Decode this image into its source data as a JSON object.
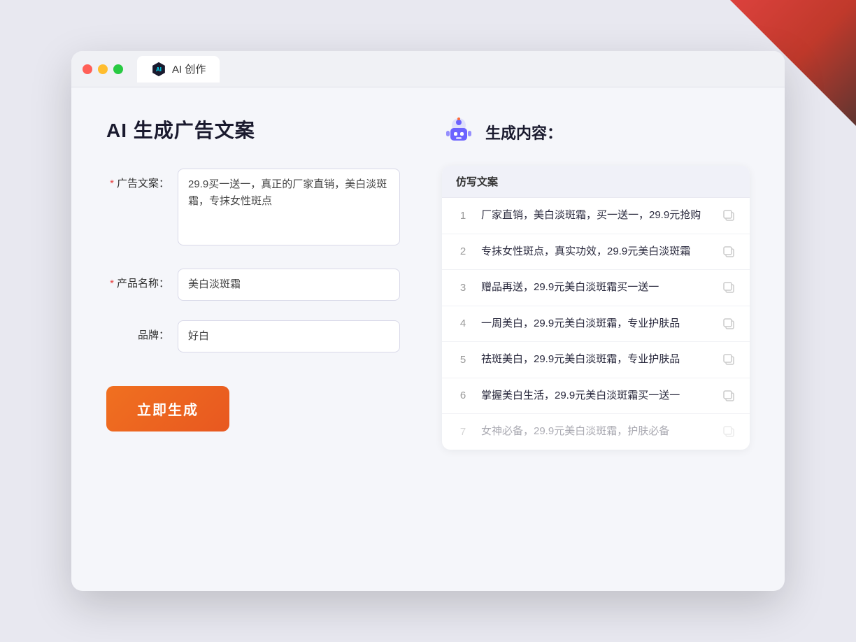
{
  "window": {
    "tab_label": "AI 创作"
  },
  "left_panel": {
    "title": "AI 生成广告文案",
    "fields": [
      {
        "id": "ad_copy",
        "label": "广告文案：",
        "required": true,
        "type": "textarea",
        "value": "29.9买一送一，真正的厂家直销，美白淡斑霜，专抹女性斑点"
      },
      {
        "id": "product_name",
        "label": "产品名称：",
        "required": true,
        "type": "input",
        "value": "美白淡斑霜"
      },
      {
        "id": "brand",
        "label": "品牌：",
        "required": false,
        "type": "input",
        "value": "好白"
      }
    ],
    "generate_button": "立即生成"
  },
  "right_panel": {
    "title": "生成内容：",
    "table_header": "仿写文案",
    "results": [
      {
        "num": "1",
        "text": "厂家直销，美白淡斑霜，买一送一，29.9元抢购",
        "faded": false
      },
      {
        "num": "2",
        "text": "专抹女性斑点，真实功效，29.9元美白淡斑霜",
        "faded": false
      },
      {
        "num": "3",
        "text": "赠品再送，29.9元美白淡斑霜买一送一",
        "faded": false
      },
      {
        "num": "4",
        "text": "一周美白，29.9元美白淡斑霜，专业护肤品",
        "faded": false
      },
      {
        "num": "5",
        "text": "祛斑美白，29.9元美白淡斑霜，专业护肤品",
        "faded": false
      },
      {
        "num": "6",
        "text": "掌握美白生活，29.9元美白淡斑霜买一送一",
        "faded": false
      },
      {
        "num": "7",
        "text": "女神必备，29.9元美白淡斑霜，护肤必备",
        "faded": true
      }
    ]
  },
  "colors": {
    "accent": "#f07020",
    "required": "#e84545"
  }
}
